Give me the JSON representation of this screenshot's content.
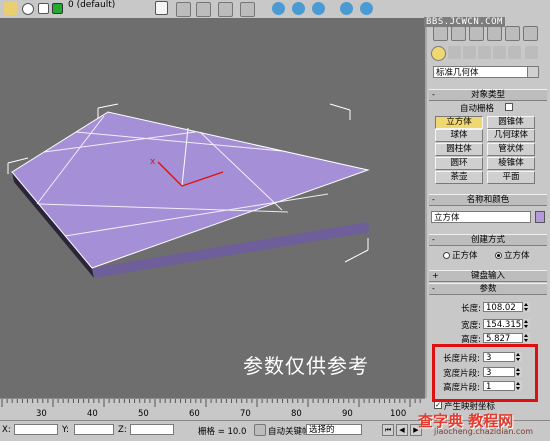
{
  "toolbar": {
    "layer_name": "0 (default)"
  },
  "watermark": {
    "site": "BBS.JCWCN.COM",
    "caption": "参数仅供参考"
  },
  "panel": {
    "category_dropdown": "标准几何体",
    "object_type": {
      "header": "对象类型",
      "autogrid_label": "自动栅格",
      "buttons": [
        "立方体",
        "圆锥体",
        "球体",
        "几何球体",
        "圆柱体",
        "管状体",
        "圆环",
        "棱锥体",
        "茶壶",
        "平面"
      ],
      "active": "立方体"
    },
    "name_color": {
      "header": "名称和颜色",
      "name_value": "立方体",
      "swatch_color": "#b49ad8"
    },
    "creation_method": {
      "header": "创建方式",
      "options": [
        "正方体",
        "立方体"
      ],
      "selected": "立方体"
    },
    "keyboard_entry": {
      "header": "键盘输入"
    },
    "parameters": {
      "header": "参数",
      "length_label": "长度:",
      "length_value": "108.02",
      "width_label": "宽度:",
      "width_value": "154.315",
      "height_label": "高度:",
      "height_value": "5.827",
      "length_segs_label": "长度片段:",
      "length_segs_value": "3",
      "width_segs_label": "宽度片段:",
      "width_segs_value": "3",
      "height_segs_label": "高度片段:",
      "height_segs_value": "1",
      "gen_mapping_label": "产生映射坐标"
    }
  },
  "timeline": {
    "ticks": [
      "30",
      "40",
      "50",
      "60",
      "70",
      "80",
      "90",
      "100"
    ]
  },
  "status": {
    "x_label": "X:",
    "y_label": "Y:",
    "z_label": "Z:",
    "grid_label": "栅格 = 10.0",
    "auto_key_label": "自动关键帧",
    "selection_value": "选择的"
  },
  "site_logo": {
    "brand": "查字典 教程网",
    "url": "jiaocheng.chazidian.com"
  },
  "colors": {
    "box_face": "#a58fd6",
    "viewport_bg": "#6e6e6e",
    "highlight": "#e01010"
  }
}
